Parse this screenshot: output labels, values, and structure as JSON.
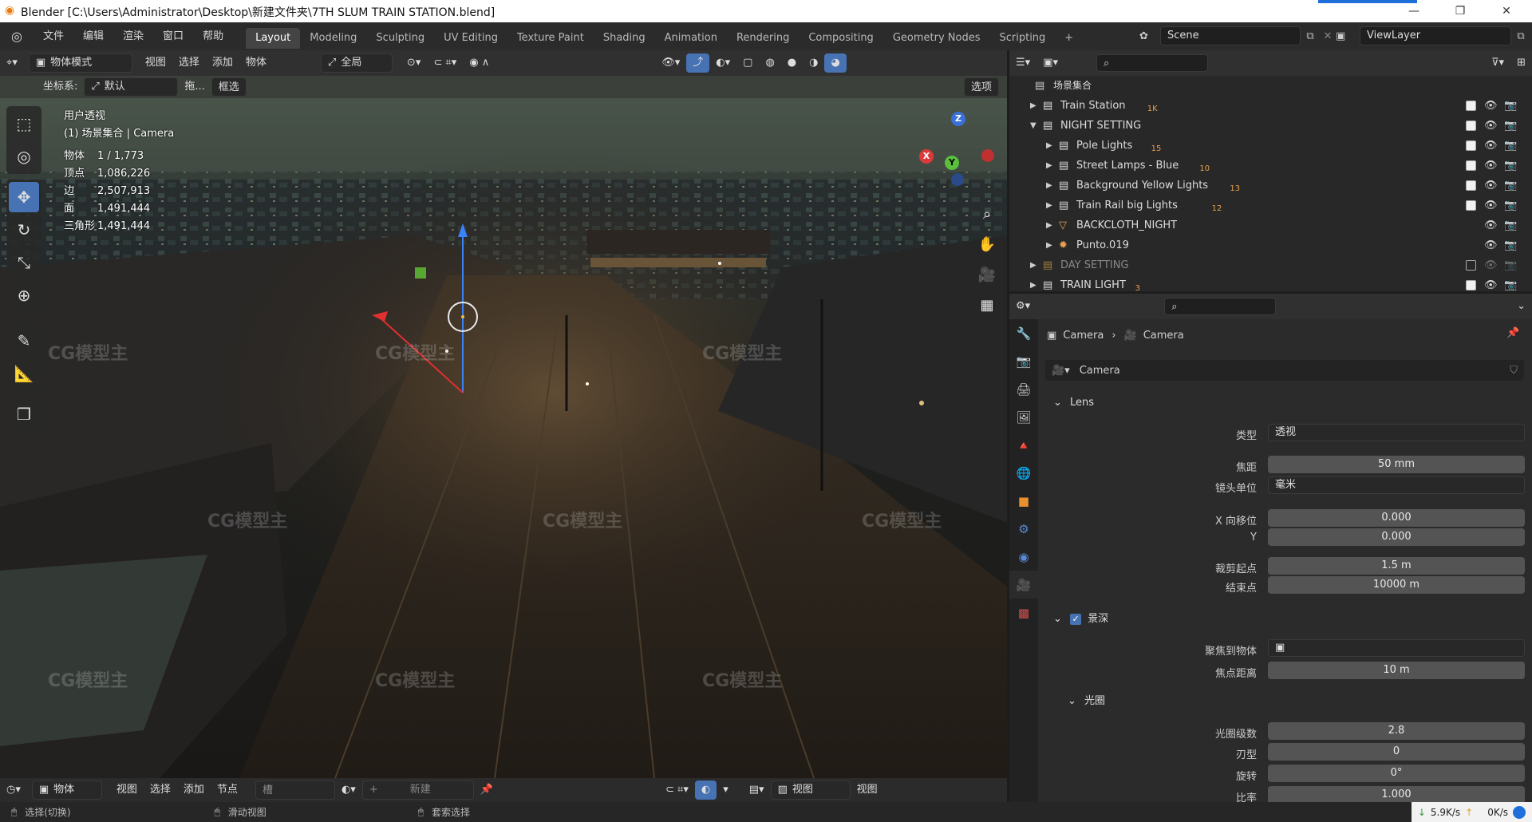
{
  "window": {
    "title": "Blender  [C:\\Users\\Administrator\\Desktop\\新建文件夹\\7TH SLUM TRAIN STATION.blend]",
    "minimize": "—",
    "maximize": "❐",
    "close": "✕"
  },
  "menu": [
    "文件",
    "编辑",
    "渲染",
    "窗口",
    "帮助"
  ],
  "workspaces": [
    "Layout",
    "Modeling",
    "Sculpting",
    "UV Editing",
    "Texture Paint",
    "Shading",
    "Animation",
    "Rendering",
    "Compositing",
    "Geometry Nodes",
    "Scripting"
  ],
  "workspace_add": "+",
  "scene": {
    "label": "Scene",
    "view_layer": "ViewLayer"
  },
  "viewport_header": {
    "mode": "物体模式",
    "menus": [
      "视图",
      "选择",
      "添加",
      "物体"
    ],
    "orientation": "全局",
    "coord_label": "坐标系:",
    "coord_value": "默认",
    "drag_label": "拖...",
    "select_mode": "框选",
    "options": "选项"
  },
  "viewport_info": {
    "view_name": "用户透视",
    "collection": "(1) 场景集合 | Camera",
    "stats": [
      {
        "key": "物体",
        "value": "1 / 1,773"
      },
      {
        "key": "顶点",
        "value": "1,086,226"
      },
      {
        "key": "边",
        "value": "2,507,913"
      },
      {
        "key": "面",
        "value": "1,491,444"
      },
      {
        "key": "三角形",
        "value": "1,491,444"
      }
    ]
  },
  "gizmo": {
    "x": "X",
    "y": "Y",
    "z": "Z"
  },
  "watermark": "CG模型主",
  "outliner": {
    "root": "场景集合",
    "rows": [
      {
        "label": "Train Station",
        "badge": "1K",
        "checked": true,
        "level": 1,
        "expanded": false
      },
      {
        "label": "NIGHT SETTING",
        "badge": "",
        "checked": true,
        "level": 1,
        "expanded": true
      },
      {
        "label": "Pole Lights",
        "badge": "15",
        "checked": true,
        "level": 2,
        "expanded": false
      },
      {
        "label": "Street Lamps - Blue",
        "badge": "10",
        "checked": true,
        "level": 2,
        "expanded": false
      },
      {
        "label": "Background Yellow Lights",
        "badge": "13",
        "checked": true,
        "level": 2,
        "expanded": false
      },
      {
        "label": "Train Rail big Lights",
        "badge": "12",
        "checked": true,
        "level": 2,
        "expanded": false
      },
      {
        "label": "BACKCLOTH_NIGHT",
        "badge": "",
        "checked": null,
        "level": 2,
        "expanded": false
      },
      {
        "label": "Punto.019",
        "badge": "",
        "checked": null,
        "level": 2,
        "expanded": false
      },
      {
        "label": "DAY SETTING",
        "badge": "",
        "checked": false,
        "level": 1,
        "expanded": false
      },
      {
        "label": "TRAIN LIGHT",
        "badge": "3",
        "checked": true,
        "level": 1,
        "expanded": false
      }
    ]
  },
  "properties": {
    "breadcrumb_object": "Camera",
    "breadcrumb_data": "Camera",
    "datablock": "Camera",
    "lens_section": "Lens",
    "rows": [
      {
        "label": "类型",
        "value": "透视",
        "kind": "select"
      },
      {
        "label": "焦距",
        "value": "50 mm",
        "kind": "value"
      },
      {
        "label": "镜头单位",
        "value": "毫米",
        "kind": "select"
      },
      {
        "label": "X 向移位",
        "value": "0.000",
        "kind": "value"
      },
      {
        "label": "Y",
        "value": "0.000",
        "kind": "value"
      },
      {
        "label": "裁剪起点",
        "value": "1.5 m",
        "kind": "value"
      },
      {
        "label": "结束点",
        "value": "10000 m",
        "kind": "value"
      }
    ],
    "dof_section": "景深",
    "dof_rows": [
      {
        "label": "聚焦到物体",
        "value": "",
        "kind": "object"
      },
      {
        "label": "焦点距离",
        "value": "10 m",
        "kind": "value"
      }
    ],
    "aperture_section": "光圈",
    "aperture_rows": [
      {
        "label": "光圈级数",
        "value": "2.8",
        "kind": "value"
      },
      {
        "label": "刃型",
        "value": "0",
        "kind": "value"
      },
      {
        "label": "旋转",
        "value": "0°",
        "kind": "value"
      },
      {
        "label": "比率",
        "value": "1.000",
        "kind": "value"
      }
    ]
  },
  "viewport_footer": {
    "mode": "物体",
    "menus": [
      "视图",
      "选择",
      "添加",
      "节点"
    ],
    "slot": "槽",
    "new": "新建",
    "view": "视图",
    "view2": "视图"
  },
  "statusbar": {
    "select": "选择(切换)",
    "pan": "滑动视图",
    "lasso": "套索选择",
    "down_rate": "5.9K/s",
    "up_rate": "0K/s"
  }
}
